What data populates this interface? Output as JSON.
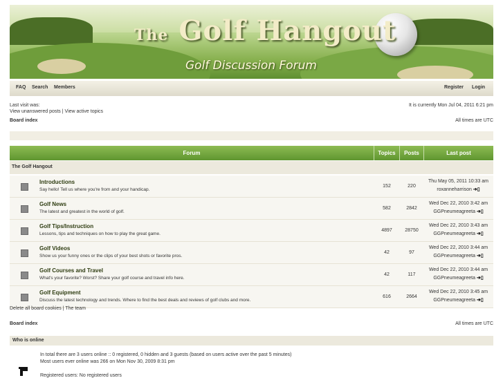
{
  "banner": {
    "title_the": "The",
    "title_main": "Golf Hangout",
    "subtitle": "Golf Discussion Forum"
  },
  "nav": {
    "faq": "FAQ",
    "search": "Search",
    "members": "Members",
    "register": "Register",
    "login": "Login"
  },
  "info": {
    "last_visit": "Last visit was:",
    "current_time": "It is currently Mon Jul 04, 2011 6:21 pm",
    "unanswered": "View unanswered posts",
    "sep": "|",
    "active": "View active topics",
    "board_index": "Board index",
    "timezone": "All times are UTC"
  },
  "table": {
    "headers": {
      "forum": "Forum",
      "topics": "Topics",
      "posts": "Posts",
      "last_post": "Last post"
    },
    "category": "The Golf Hangout",
    "goto_icon": "➔▯",
    "rows": [
      {
        "name": "Introductions",
        "desc": "Say hello! Tell us where you're from and your handicap.",
        "topics": "152",
        "posts": "220",
        "lp_date": "Thu May 05, 2011 10:33 am",
        "lp_user": "roxanneharrison"
      },
      {
        "name": "Golf News",
        "desc": "The latest and greatest in the world of golf.",
        "topics": "582",
        "posts": "2842",
        "lp_date": "Wed Dec 22, 2010 3:42 am",
        "lp_user": "GGPneumeagreeta"
      },
      {
        "name": "Golf Tips/Instruction",
        "desc": "Lessons, tips and techniques on how to play the great game.",
        "topics": "4897",
        "posts": "28750",
        "lp_date": "Wed Dec 22, 2010 3:43 am",
        "lp_user": "GGPneumeagreeta"
      },
      {
        "name": "Golf Videos",
        "desc": "Show us your funny ones or the clips of your best shots or favorite pros.",
        "topics": "42",
        "posts": "97",
        "lp_date": "Wed Dec 22, 2010 3:44 am",
        "lp_user": "GGPneumeagreeta"
      },
      {
        "name": "Golf Courses and Travel",
        "desc": "What's your favorite? Worst? Share your golf course and travel info here.",
        "topics": "42",
        "posts": "117",
        "lp_date": "Wed Dec 22, 2010 3:44 am",
        "lp_user": "GGPneumeagreeta"
      },
      {
        "name": "Golf Equipment",
        "desc": "Discuss the latest technology and trends. Where to find the best deals and reviews of golf clubs and more.",
        "topics": "616",
        "posts": "2664",
        "lp_date": "Wed Dec 22, 2010 3:45 am",
        "lp_user": "GGPneumeagreeta"
      }
    ]
  },
  "footer": {
    "delete_cookies": "Delete all board cookies",
    "sep": "|",
    "team": "The team",
    "board_index": "Board index",
    "timezone": "All times are UTC"
  },
  "who_is_online": {
    "title": "Who is online",
    "line1": "In total there are 3 users online :: 0 registered, 0 hidden and 3 guests (based on users active over the past 5 minutes)",
    "line2": "Most users ever online was 266 on Mon Nov 30, 2009 8:31 pm",
    "line3": "Registered users: No registered users"
  }
}
